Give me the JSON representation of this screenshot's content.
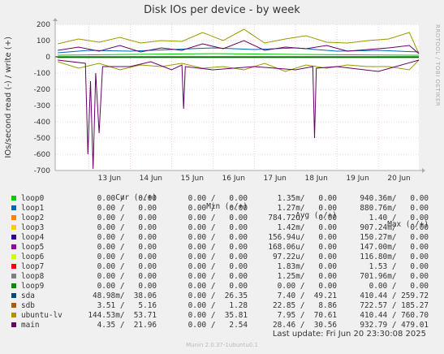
{
  "title": "Disk IOs per device - by week",
  "side_label": "RRDTOOL / TOBI OETIKER",
  "ylabel": "IOs/second read (-) / write (+)",
  "chart_data": {
    "type": "line",
    "ylim": [
      -700,
      200
    ],
    "y_ticks": [
      "200",
      "100",
      "0",
      "-100",
      "-200",
      "-300",
      "-400",
      "-500",
      "-600",
      "-700"
    ],
    "x_ticks": [
      "13 Jun",
      "14 Jun",
      "15 Jun",
      "16 Jun",
      "17 Jun",
      "18 Jun",
      "19 Jun",
      "20 Jun"
    ],
    "grid": true,
    "series": [
      {
        "name": "sdb",
        "color": "#0066b3",
        "write": [
          [
            "2025-06-12 06:00",
            25
          ],
          [
            "2025-06-13 00:00",
            40
          ],
          [
            "2025-06-14 00:00",
            35
          ],
          [
            "2025-06-15 00:00",
            45
          ],
          [
            "2025-06-16 00:00",
            55
          ],
          [
            "2025-06-17 00:00",
            45
          ],
          [
            "2025-06-18 00:00",
            55
          ],
          [
            "2025-06-19 00:00",
            35
          ],
          [
            "2025-06-20 00:00",
            40
          ],
          [
            "2025-06-20 23:30",
            30
          ]
        ],
        "read": [
          [
            "2025-06-12 06:00",
            -5
          ],
          [
            "2025-06-16 00:00",
            -5
          ],
          [
            "2025-06-20 23:30",
            -5
          ]
        ]
      },
      {
        "name": "sda",
        "color": "#00cc00",
        "write": [
          [
            "2025-06-12 06:00",
            10
          ],
          [
            "2025-06-14 00:00",
            15
          ],
          [
            "2025-06-16 00:00",
            20
          ],
          [
            "2025-06-18 00:00",
            15
          ],
          [
            "2025-06-20 23:30",
            10
          ]
        ],
        "read": [
          [
            "2025-06-12 06:00",
            -5
          ],
          [
            "2025-06-20 23:30",
            -5
          ]
        ]
      },
      {
        "name": "ubuntu-lv",
        "color": "#999900",
        "write": [
          [
            "2025-06-12 06:00",
            80
          ],
          [
            "2025-06-12 18:00",
            110
          ],
          [
            "2025-06-13 06:00",
            90
          ],
          [
            "2025-06-13 18:00",
            120
          ],
          [
            "2025-06-14 06:00",
            85
          ],
          [
            "2025-06-14 18:00",
            100
          ],
          [
            "2025-06-15 06:00",
            95
          ],
          [
            "2025-06-15 18:00",
            150
          ],
          [
            "2025-06-16 06:00",
            100
          ],
          [
            "2025-06-16 18:00",
            170
          ],
          [
            "2025-06-17 06:00",
            85
          ],
          [
            "2025-06-17 18:00",
            110
          ],
          [
            "2025-06-18 06:00",
            130
          ],
          [
            "2025-06-18 18:00",
            90
          ],
          [
            "2025-06-19 06:00",
            85
          ],
          [
            "2025-06-19 18:00",
            100
          ],
          [
            "2025-06-20 06:00",
            110
          ],
          [
            "2025-06-20 18:00",
            150
          ],
          [
            "2025-06-20 23:30",
            20
          ]
        ],
        "read": [
          [
            "2025-06-12 06:00",
            -30
          ],
          [
            "2025-06-12 18:00",
            -70
          ],
          [
            "2025-06-13 06:00",
            -40
          ],
          [
            "2025-06-13 18:00",
            -80
          ],
          [
            "2025-06-14 06:00",
            -50
          ],
          [
            "2025-06-14 18:00",
            -60
          ],
          [
            "2025-06-15 06:00",
            -40
          ],
          [
            "2025-06-15 18:00",
            -70
          ],
          [
            "2025-06-16 06:00",
            -60
          ],
          [
            "2025-06-16 18:00",
            -80
          ],
          [
            "2025-06-17 06:00",
            -40
          ],
          [
            "2025-06-17 18:00",
            -90
          ],
          [
            "2025-06-18 06:00",
            -50
          ],
          [
            "2025-06-18 18:00",
            -70
          ],
          [
            "2025-06-19 06:00",
            -50
          ],
          [
            "2025-06-19 18:00",
            -60
          ],
          [
            "2025-06-20 06:00",
            -60
          ],
          [
            "2025-06-20 18:00",
            -80
          ],
          [
            "2025-06-20 23:30",
            -20
          ]
        ]
      },
      {
        "name": "main",
        "color": "#660066",
        "write": [
          [
            "2025-06-12 06:00",
            40
          ],
          [
            "2025-06-12 18:00",
            60
          ],
          [
            "2025-06-13 06:00",
            35
          ],
          [
            "2025-06-13 18:00",
            70
          ],
          [
            "2025-06-14 06:00",
            30
          ],
          [
            "2025-06-14 18:00",
            55
          ],
          [
            "2025-06-15 06:00",
            40
          ],
          [
            "2025-06-15 18:00",
            80
          ],
          [
            "2025-06-16 06:00",
            50
          ],
          [
            "2025-06-16 18:00",
            100
          ],
          [
            "2025-06-17 06:00",
            40
          ],
          [
            "2025-06-17 18:00",
            60
          ],
          [
            "2025-06-18 06:00",
            50
          ],
          [
            "2025-06-18 18:00",
            70
          ],
          [
            "2025-06-19 06:00",
            35
          ],
          [
            "2025-06-19 18:00",
            45
          ],
          [
            "2025-06-20 06:00",
            55
          ],
          [
            "2025-06-20 18:00",
            70
          ],
          [
            "2025-06-20 23:30",
            20
          ]
        ],
        "read": [
          [
            "2025-06-12 06:00",
            -20
          ],
          [
            "2025-06-12 22:00",
            -40
          ],
          [
            "2025-06-12 23:30",
            -600
          ],
          [
            "2025-06-13 01:00",
            -150
          ],
          [
            "2025-06-13 02:30",
            -690
          ],
          [
            "2025-06-13 04:00",
            -100
          ],
          [
            "2025-06-13 06:00",
            -470
          ],
          [
            "2025-06-13 08:00",
            -60
          ],
          [
            "2025-06-14 00:00",
            -60
          ],
          [
            "2025-06-14 12:00",
            -30
          ],
          [
            "2025-06-15 00:00",
            -80
          ],
          [
            "2025-06-15 06:00",
            -50
          ],
          [
            "2025-06-15 07:00",
            -320
          ],
          [
            "2025-06-15 08:00",
            -60
          ],
          [
            "2025-06-16 00:00",
            -80
          ],
          [
            "2025-06-17 00:00",
            -60
          ],
          [
            "2025-06-18 00:00",
            -80
          ],
          [
            "2025-06-18 10:00",
            -60
          ],
          [
            "2025-06-18 11:00",
            -500
          ],
          [
            "2025-06-18 12:00",
            -70
          ],
          [
            "2025-06-19 00:00",
            -60
          ],
          [
            "2025-06-20 00:00",
            -90
          ],
          [
            "2025-06-20 23:30",
            -20
          ]
        ]
      }
    ]
  },
  "legend": {
    "headers": [
      "Cur (-/+)",
      "Min (-/+)",
      "Avg (-/+)",
      "Max (-/+)"
    ],
    "rows": [
      {
        "name": "loop0",
        "color": "#00cc00",
        "cur": "0.00 /   0.00",
        "min": "0.00 /   0.00",
        "avg": "1.35m/   0.00",
        "max": "940.36m/   0.00"
      },
      {
        "name": "loop1",
        "color": "#0066b3",
        "cur": "0.00 /   0.00",
        "min": "0.00 /   0.00",
        "avg": "1.27m/   0.00",
        "max": "880.76m/   0.00"
      },
      {
        "name": "loop2",
        "color": "#ff8000",
        "cur": "0.00 /   0.00",
        "min": "0.00 /   0.00",
        "avg": "784.72u/   0.00",
        "max": "1.40 /   0.00"
      },
      {
        "name": "loop3",
        "color": "#ffcc00",
        "cur": "0.00 /   0.00",
        "min": "0.00 /   0.00",
        "avg": "1.42m/   0.00",
        "max": "907.24m/   0.00"
      },
      {
        "name": "loop4",
        "color": "#330099",
        "cur": "0.00 /   0.00",
        "min": "0.00 /   0.00",
        "avg": "156.94u/   0.00",
        "max": "150.27m/   0.00"
      },
      {
        "name": "loop5",
        "color": "#990099",
        "cur": "0.00 /   0.00",
        "min": "0.00 /   0.00",
        "avg": "168.06u/   0.00",
        "max": "147.00m/   0.00"
      },
      {
        "name": "loop6",
        "color": "#ccff00",
        "cur": "0.00 /   0.00",
        "min": "0.00 /   0.00",
        "avg": "97.22u/   0.00",
        "max": "116.80m/   0.00"
      },
      {
        "name": "loop7",
        "color": "#ff0000",
        "cur": "0.00 /   0.00",
        "min": "0.00 /   0.00",
        "avg": "1.83m/   0.00",
        "max": "1.53 /   0.00"
      },
      {
        "name": "loop8",
        "color": "#808080",
        "cur": "0.00 /   0.00",
        "min": "0.00 /   0.00",
        "avg": "1.25m/   0.00",
        "max": "701.96m/   0.00"
      },
      {
        "name": "loop9",
        "color": "#008f00",
        "cur": "0.00 /   0.00",
        "min": "0.00 /   0.00",
        "avg": "0.00 /   0.00",
        "max": "0.00 /   0.00"
      },
      {
        "name": "sda",
        "color": "#00487d",
        "cur": "48.98m/  38.06",
        "min": "0.00 /  26.35",
        "avg": "7.40 /  49.21",
        "max": "410.44 / 259.72"
      },
      {
        "name": "sdb",
        "color": "#b35a00",
        "cur": "3.51 /   5.16",
        "min": "0.00 /   1.28",
        "avg": "22.85 /   8.86",
        "max": "722.57 / 185.27"
      },
      {
        "name": "ubuntu-lv",
        "color": "#b38f00",
        "cur": "144.53m/  53.71",
        "min": "0.00 /  35.81",
        "avg": "7.95 /  70.61",
        "max": "410.44 / 760.70"
      },
      {
        "name": "main",
        "color": "#6b006b",
        "cur": "4.35 /  21.96",
        "min": "0.00 /   2.54",
        "avg": "28.46 /  30.56",
        "max": "932.79 / 479.01"
      }
    ]
  },
  "last_update": "Last update: Fri Jun 20 23:30:08 2025",
  "footer": "Munin 2.0.37-1ubuntu0.1"
}
